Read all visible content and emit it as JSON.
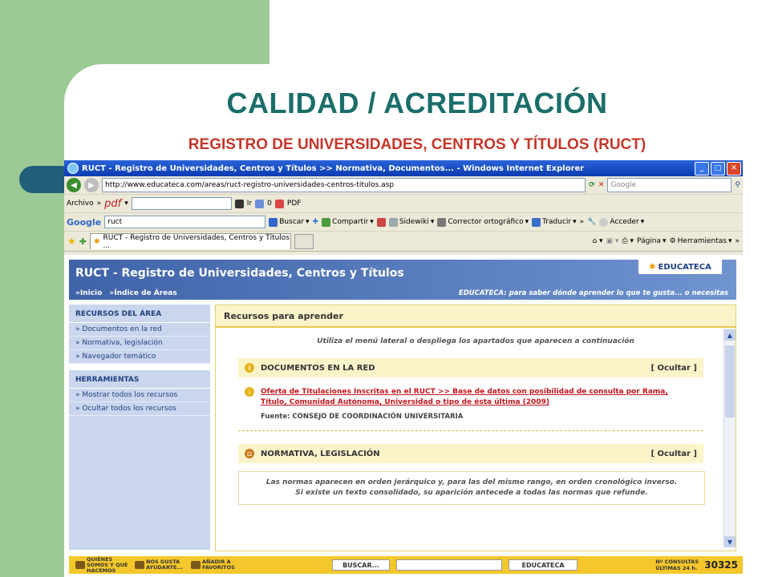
{
  "slide": {
    "title": "CALIDAD / ACREDITACIÓN",
    "subtitle": "REGISTRO DE UNIVERSIDADES, CENTROS Y TÍTULOS (RUCT)"
  },
  "window": {
    "title": "RUCT - Registro de Universidades, Centros y Títulos >> Normativa, Documentos... - Windows Internet Explorer"
  },
  "addressbar": {
    "url": "http://www.educateca.com/areas/ruct-registro-universidades-centros-titulos.asp",
    "search_placeholder": "Google"
  },
  "toolbar_pdf": {
    "archivo": "Archivo",
    "chevron": "»",
    "pdf_label": "pdf",
    "ir": "Ir",
    "count": "0",
    "pdf_btn": "PDF"
  },
  "google_bar": {
    "brand": "Google",
    "query": "ruct",
    "buscar": "Buscar",
    "compartir": "Compartir",
    "sidewiki": "Sidewiki",
    "corrector": "Corrector ortográfico",
    "traducir": "Traducir",
    "acceder": "Acceder"
  },
  "tabs": {
    "active": "RUCT - Registro de Universidades, Centros y Títulos ...",
    "pagina": "Página",
    "herramientas": "Herramientas"
  },
  "page": {
    "header_title": "RUCT - Registro de Universidades, Centros y Títulos",
    "nav_inicio": "»Inicio",
    "nav_indice": "»Índice de Áreas",
    "tagline": "EDUCATECA: para saber dónde aprender lo que te gusta... o necesitas",
    "logo": "EDUCATECA",
    "sidebar": {
      "section1": "RECURSOS DEL ÁREA",
      "links1": [
        "»  Documentos en la red",
        "»  Normativa, legislación",
        "»  Navegador temático"
      ],
      "section2": "HERRAMIENTAS",
      "links2": [
        "»  Mostrar todos los recursos",
        "»  Ocultar todos los recursos"
      ]
    },
    "main": {
      "heading": "Recursos para aprender",
      "intro": "Utiliza el menú lateral o despliega los apartados que aparecen a continuación",
      "section1": "DOCUMENTOS EN LA RED",
      "ocultar": "[ Ocultar ]",
      "resource_link": "Oferta de Titulaciones Inscritas en el RUCT >> Base de datos con posibilidad de consulta por Rama, Título, Comunidad Autónoma, Universidad o tipo de ésta última (2009)",
      "resource_source": "Fuente: CONSEJO DE COORDINACIÓN UNIVERSITARIA",
      "section2": "NORMATIVA, LEGISLACIÓN",
      "note_line1": "Las normas aparecen en orden jerárquico y, para las del mismo rango, en orden cronológico inverso.",
      "note_line2": "Si existe un texto consolidado, su aparición antecede a todas las normas que refunde."
    },
    "footer": {
      "quienes": "QUIÉNES SOMOS Y QUÉ HACEMOS",
      "nos_gusta": "NOS GUSTA AYUDARTE...",
      "anadir": "AÑADIR A FAVORITOS",
      "buscar_btn": "BUSCAR...",
      "educateca_btn": "EDUCATECA",
      "consultas_label": "Nº CONSULTAS ÚLTIMAS 24 h.",
      "consultas": "30325"
    }
  }
}
